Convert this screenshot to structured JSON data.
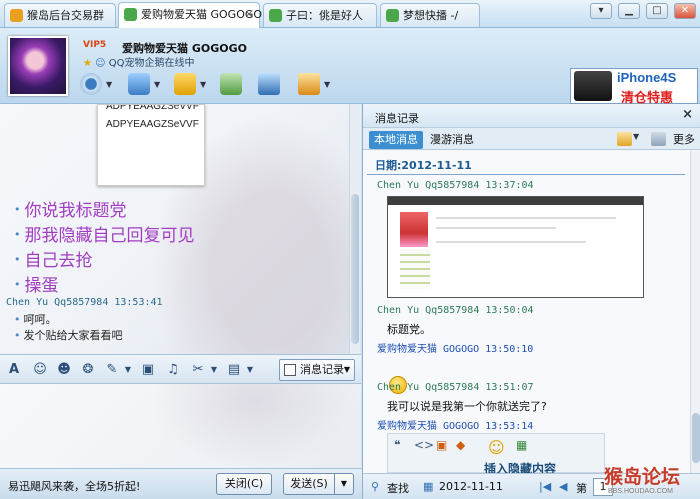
{
  "tabs": [
    {
      "label": "猴岛后台交易群",
      "active": false
    },
    {
      "label": "爱购物爱天猫 GOGOGO",
      "active": true
    },
    {
      "label": "子曰：佻是好人",
      "active": false
    },
    {
      "label": "梦想快播 -/",
      "active": false
    }
  ],
  "window": {
    "tab_menu": "▾",
    "minimize": "▁",
    "maximize": "□"
  },
  "header": {
    "vip": "VIP5",
    "buddy_name": "爱购物爱天猫 GOGOGO",
    "status": "QQ宠物企鹅在线中"
  },
  "ad": {
    "line1": "iPhone4S",
    "line2": "清仓特惠"
  },
  "chat": {
    "snippet": [
      "ADPYEAAGZSeVVF",
      "ADPYEAAGZSeVVF"
    ],
    "big_lines": [
      "你说我标题党",
      "那我隐藏自己回复可见",
      "自己去抢",
      "操蛋"
    ],
    "sender": "Chen Yu Qq5857984  13:53:41",
    "small_lines": [
      "呵呵。",
      "发个贴给大家看看吧"
    ]
  },
  "toolbar": {
    "history_button": "消息记录"
  },
  "bottom": {
    "promo": "易迅飓风来袭，全场5折起!",
    "close_label": "关闭(C)",
    "send_label": "发送(S)"
  },
  "history": {
    "title": "消息记录",
    "tab_local": "本地消息",
    "tab_roaming": "漫游消息",
    "more": "更多",
    "date": "日期:2012-11-11",
    "messages": [
      {
        "head": "Chen Yu Qq5857984  13:37:04",
        "text": ""
      },
      {
        "head": "Chen Yu Qq5857984  13:50:04",
        "text": "标题党。"
      },
      {
        "head": "爱购物爱天猫 GOGOGO  13:50:10",
        "text": ""
      },
      {
        "head": "Chen Yu Qq5857984  13:51:07",
        "text": "我可以说是我第一个你就送完了?"
      },
      {
        "head": "爱购物爱天猫 GOGOGO  13:53:14",
        "text": ""
      }
    ],
    "partial_text": "插入隐藏内容",
    "footer": {
      "search": "查找",
      "date": "2012-11-11",
      "page_label": "第",
      "page": "1"
    }
  },
  "watermark": {
    "title": "猴岛论坛",
    "sub": "BBS.HOUDAO.COM"
  },
  "colors": {
    "accent": "#3b8fd0",
    "purple_text": "#a23dc2",
    "sender_green": "#2f7a57",
    "self_blue": "#1f4fb0"
  }
}
